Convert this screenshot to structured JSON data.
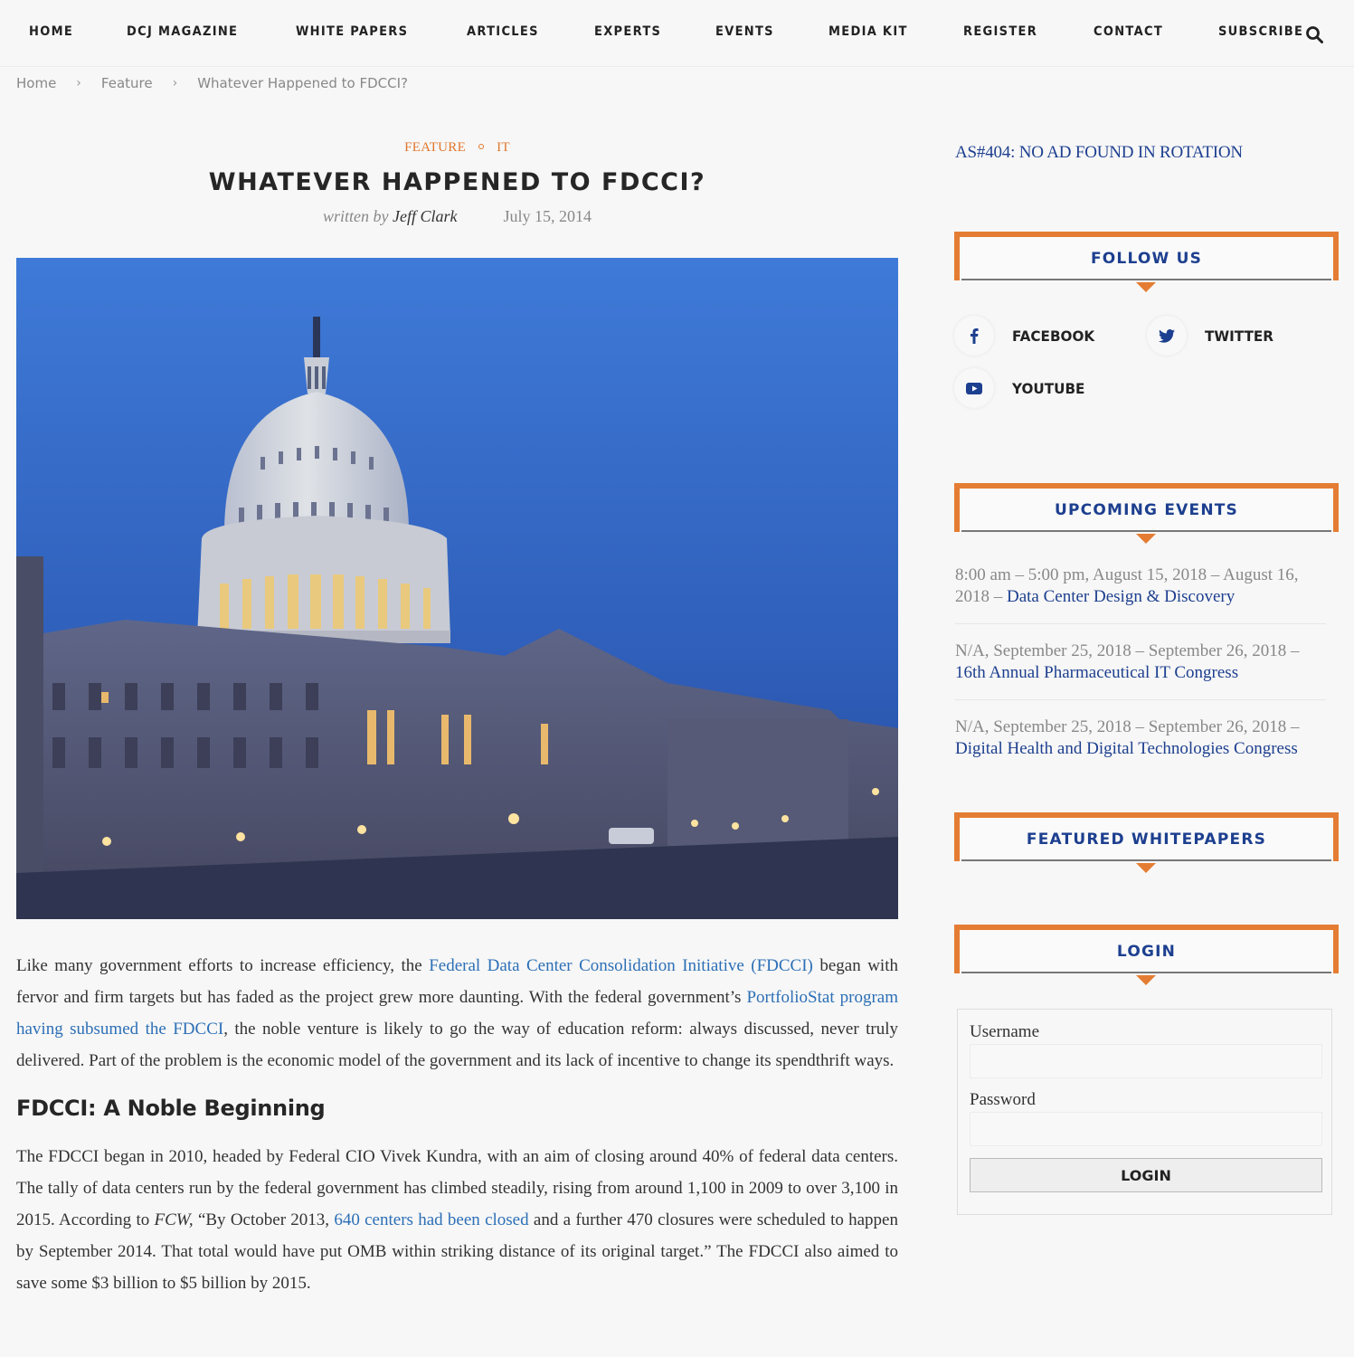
{
  "nav": {
    "items": [
      "HOME",
      "DCJ MAGAZINE",
      "WHITE PAPERS",
      "ARTICLES",
      "EXPERTS",
      "EVENTS",
      "MEDIA KIT",
      "REGISTER",
      "CONTACT",
      "SUBSCRIBE"
    ],
    "search_icon": "search-icon"
  },
  "breadcrumb": {
    "items": [
      "Home",
      "Feature",
      "Whatever Happened to FDCCI?"
    ],
    "separator": "›"
  },
  "article": {
    "categories": [
      "FEATURE",
      "IT"
    ],
    "title": "WHATEVER HAPPENED TO FDCCI?",
    "written_by": "written by",
    "author": "Jeff Clark",
    "date": "July 15, 2014",
    "image_alt": "U.S. Capitol building at dusk",
    "p1": {
      "t1": "Like many government efforts to increase efficiency, the ",
      "link1": "Federal Data Center Consolidation Initiative (FDCCI)",
      "t2": " began with fervor and firm targets but has faded as the project grew more daunting. With the federal government’s ",
      "link2": "PortfolioStat program having subsumed the FDCCI",
      "t3": ", the noble venture is likely to go the way of education reform: always discussed, never truly delivered. Part of the problem is the economic model of the government and its lack of incentive to change its spendthrift ways."
    },
    "h2": "FDCCI: A Noble Beginning",
    "p2": {
      "t1": "The FDCCI began in 2010, headed by Federal CIO Vivek Kundra, with an aim of closing around 40% of federal data centers. The tally of data centers run by the federal government has climbed steadily, rising from around 1,100 in 2009 to over 3,100 in 2015. According to ",
      "em": "FCW,",
      "t2": " “By October 2013, ",
      "link": "640 centers had been closed",
      "t3": " and a further 470 closures were scheduled to happen by September 2014. That total would have put OMB within striking distance of its original target.” The FDCCI also aimed to save some $3 billion to $5 billion by 2015."
    }
  },
  "sidebar": {
    "ad_text": "AS#404: NO AD FOUND IN ROTATION",
    "follow": {
      "title": "FOLLOW US",
      "items": [
        {
          "label": "FACEBOOK",
          "icon": "facebook-icon"
        },
        {
          "label": "TWITTER",
          "icon": "twitter-icon"
        },
        {
          "label": "YOUTUBE",
          "icon": "youtube-icon"
        }
      ]
    },
    "events": {
      "title": "UPCOMING EVENTS",
      "items": [
        {
          "when": "8:00 am – 5:00 pm, August 15, 2018 – August 16, 2018 – ",
          "name": "Data Center Design & Discovery"
        },
        {
          "when": "N/A, September 25, 2018 – September 26, 2018 – ",
          "name": "16th Annual Pharmaceutical IT Congress"
        },
        {
          "when": "N/A, September 25, 2018 – September 26, 2018 – ",
          "name": "Digital Health and Digital Technologies Congress"
        }
      ]
    },
    "whitepapers": {
      "title": "FEATURED WHITEPAPERS"
    },
    "login": {
      "title": "LOGIN",
      "username_label": "Username",
      "username_value": "",
      "password_label": "Password",
      "password_value": "",
      "button": "LOGIN"
    }
  },
  "colors": {
    "accent": "#e47d33",
    "link": "#2c6fb6",
    "sidebar_link": "#1d3f8f",
    "text": "#333333"
  }
}
